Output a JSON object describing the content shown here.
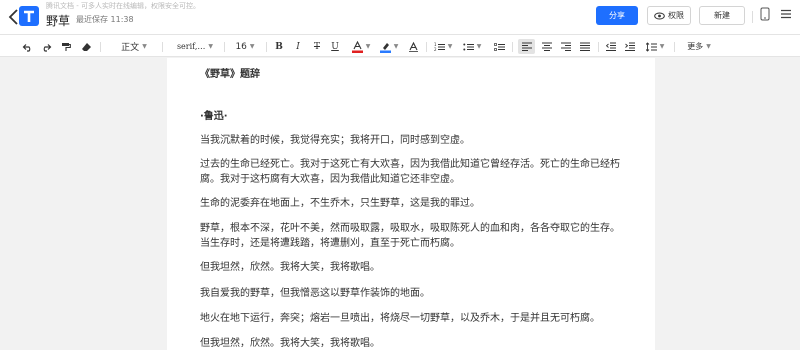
{
  "header": {
    "hint": "腾讯文档 - 可多人实时在线编辑，权限安全可控。",
    "title": "野草",
    "saved": "最近保存 11:38",
    "share": "分享",
    "permission": "权限",
    "new": "新建"
  },
  "toolbar": {
    "style": "正文",
    "font": "serif,…",
    "size": "16",
    "more": "更多",
    "colors": {
      "underline": "#e02020",
      "highlight": "#2a7bff"
    }
  },
  "document": {
    "paragraphs": [
      "《野草》题辞",
      "·鲁迅·",
      "当我沉默着的时候，我觉得充实；我将开口，同时感到空虚。",
      "过去的生命已经死亡。我对于这死亡有大欢喜，因为我借此知道它曾经存活。死亡的生命已经朽",
      "腐。我对于这朽腐有大欢喜，因为我借此知道它还非空虚。",
      "生命的泥委弃在地面上，不生乔木，只生野草，这是我的罪过。",
      "野草，根本不深，花叶不美，然而吸取露，吸取水，吸取陈死人的血和肉，各各夺取它的生存。",
      "当生存时，还是将遭践踏，将遭删刈，直至于死亡而朽腐。",
      "但我坦然，欣然。我将大笑，我将歌唱。",
      "我自爱我的野草，但我憎恶这以野草作装饰的地面。",
      "地火在地下运行，奔突；熔岩一旦喷出，将烧尽一切野草，以及乔木，于是并且无可朽腐。",
      "但我坦然，欣然。我将大笑，我将歌唱。"
    ]
  }
}
